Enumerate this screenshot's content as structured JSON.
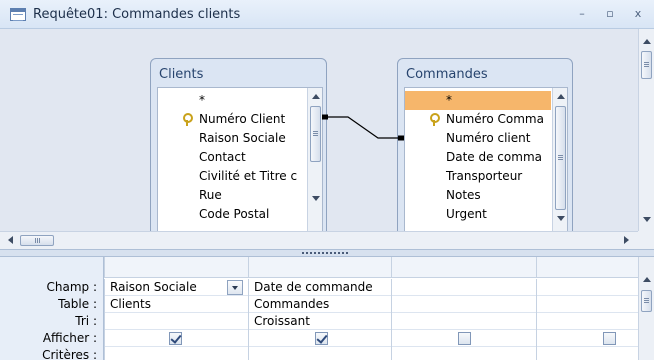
{
  "window": {
    "title": "Requête01: Commandes clients",
    "minimize_glyph": "–",
    "maximize_glyph": "▫",
    "close_glyph": "x"
  },
  "tables": [
    {
      "name": "Clients",
      "fields": [
        "*",
        "Numéro Client",
        "Raison Sociale",
        "Contact",
        "Civilité et Titre c",
        "Rue",
        "Code Postal"
      ],
      "key_field_index": 1
    },
    {
      "name": "Commandes",
      "fields": [
        "*",
        "Numéro Comma",
        "Numéro client",
        "Date de comma",
        "Transporteur",
        "Notes",
        "Urgent"
      ],
      "key_field_index": 1,
      "selected_field_index": 0
    }
  ],
  "grid": {
    "row_labels": {
      "champ": "Champ :",
      "table": "Table :",
      "tri": "Tri :",
      "afficher": "Afficher :",
      "criteres": "Critères :"
    },
    "columns": [
      {
        "champ": "Raison Sociale",
        "table": "Clients",
        "tri": "",
        "afficher": true
      },
      {
        "champ": "Date de commande",
        "table": "Commandes",
        "tri": "Croissant",
        "afficher": true
      },
      {
        "champ": "",
        "table": "",
        "tri": "",
        "afficher": false
      },
      {
        "champ": "",
        "table": "",
        "tri": "",
        "afficher": false
      }
    ]
  },
  "colors": {
    "selected_field": "#f6b66b",
    "design_background": "#e1e7f1",
    "key_icon": "#c9a21b"
  }
}
